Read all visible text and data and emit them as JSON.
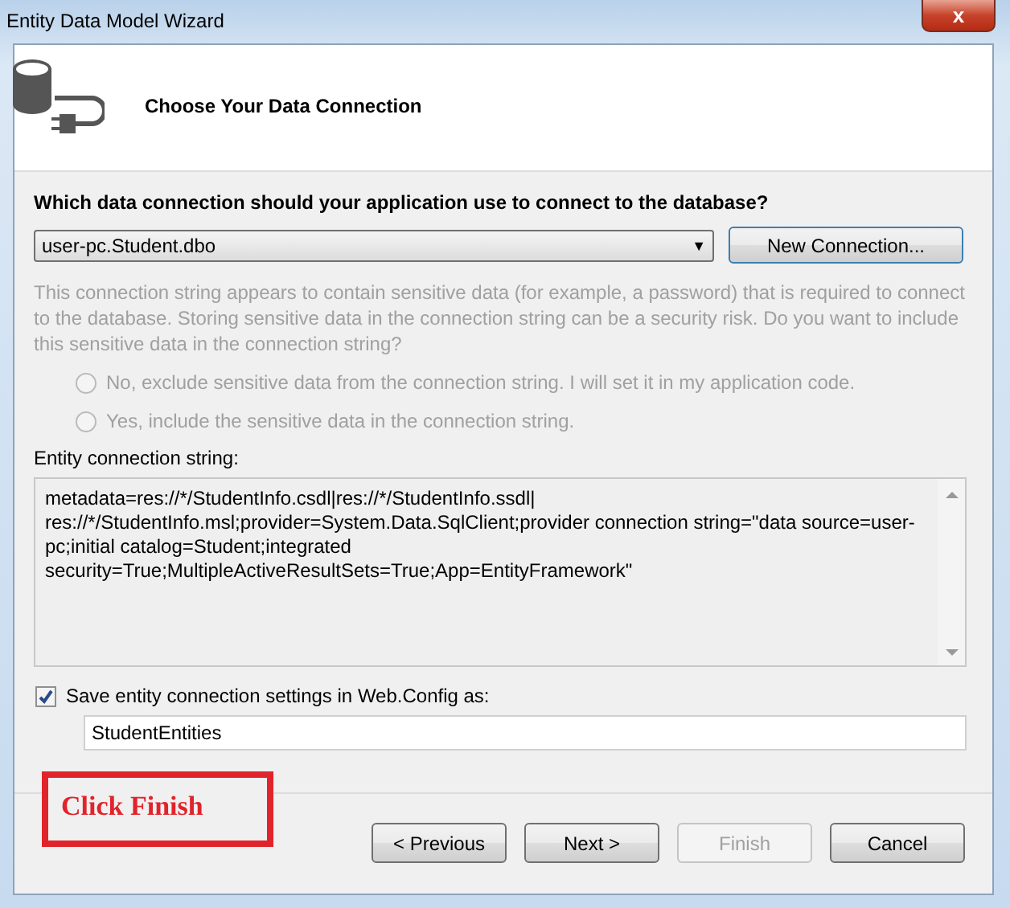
{
  "window": {
    "title": "Entity Data Model Wizard",
    "close": "x"
  },
  "header": {
    "title": "Choose Your Data Connection"
  },
  "question": "Which data connection should your application use to connect to the database?",
  "connection": {
    "value": "user-pc.Student.dbo",
    "arrow": "▼"
  },
  "new_connection_button": "New Connection...",
  "sensitive_notice": {
    "text": "This connection string appears to contain sensitive data (for example, a password) that is required to connect to the database. Storing sensitive data in the connection string can be a security risk. Do you want to include this sensitive data in the connection string?",
    "disabled": true
  },
  "options": [
    {
      "label": "No, exclude sensitive data from the connection string. I will set it in my application code.",
      "selected": false,
      "disabled": true
    },
    {
      "label": "Yes, include the sensitive data in the connection string.",
      "selected": false,
      "disabled": true
    }
  ],
  "entity_label": "Entity connection string:",
  "entity_string": [
    "metadata=res://*/StudentInfo.csdl|res://*/StudentInfo.ssdl|",
    "res://*/StudentInfo.msl;provider=System.Data.SqlClient;provider connection string=\"data source=user-",
    "pc;initial catalog=Student;integrated",
    "security=True;MultipleActiveResultSets=True;App=EntityFramework\""
  ],
  "save_setting": {
    "label": "Save entity connection settings in Web.Config as:",
    "checked": true,
    "value": "StudentEntities"
  },
  "annotation": "Click Finish",
  "buttons": [
    {
      "label": "< Previous",
      "disabled": false
    },
    {
      "label": "Next >",
      "disabled": false
    },
    {
      "label": "Finish",
      "disabled": true
    },
    {
      "label": "Cancel",
      "disabled": false
    }
  ]
}
